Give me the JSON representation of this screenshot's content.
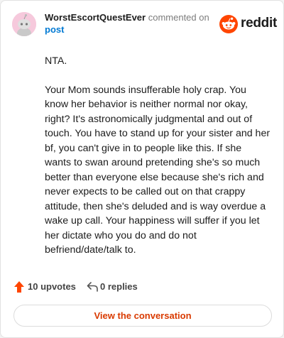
{
  "comment": {
    "username": "WorstEscortQuestEver",
    "action_text": "commented on",
    "post_link_text": "post",
    "paragraphs": [
      "NTA.",
      "Your Mom sounds insufferable holy crap. You know her behavior is neither normal nor okay, right? It's astronomically judgmental and out of touch. You have to stand up for your sister and her bf, you can't give in to people like this. If she wants to swan around pretending she's so much better than everyone else because she's rich and never expects to be called out on that crappy attitude, then she's deluded and is way overdue a wake up call. Your happiness will suffer if you let her dictate who you do and do not befriend/date/talk to."
    ]
  },
  "brand": {
    "name": "reddit",
    "icon": "reddit-logo-icon",
    "color": "#ff4500"
  },
  "actions": {
    "upvotes_label": "10 upvotes",
    "replies_label": "0 replies",
    "upvote_icon": "upvote-arrow-icon",
    "reply_icon": "reply-arrow-icon"
  },
  "cta": {
    "label": "View the conversation",
    "color": "#d93a00"
  }
}
